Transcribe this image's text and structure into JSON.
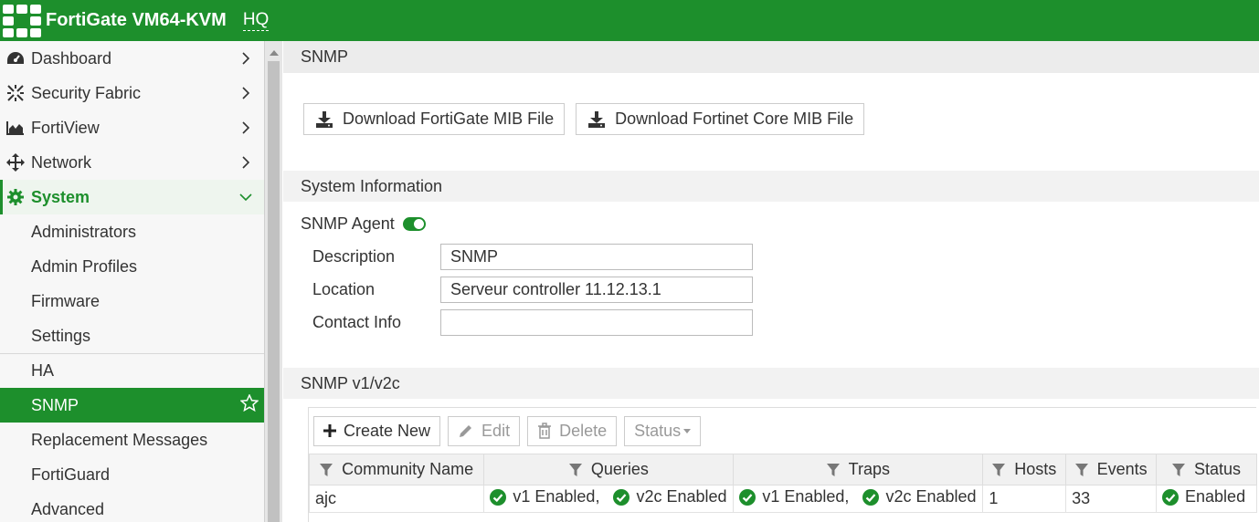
{
  "topbar": {
    "title": "FortiGate VM64-KVM",
    "vdom": "HQ"
  },
  "sidebar": {
    "items": [
      {
        "label": "Dashboard",
        "icon": "dashboard-icon"
      },
      {
        "label": "Security Fabric",
        "icon": "security-fabric-icon"
      },
      {
        "label": "FortiView",
        "icon": "fortiview-icon"
      },
      {
        "label": "Network",
        "icon": "network-move-icon"
      },
      {
        "label": "System",
        "icon": "gear-icon"
      }
    ],
    "system_children": [
      "Administrators",
      "Admin Profiles",
      "Firmware",
      "Settings",
      "HA",
      "SNMP",
      "Replacement Messages",
      "FortiGuard",
      "Advanced"
    ]
  },
  "page": {
    "title": "SNMP",
    "download_fortigate_mib": "Download FortiGate MIB File",
    "download_core_mib": "Download Fortinet Core MIB File",
    "system_info_header": "System Information",
    "snmp_agent_label": "SNMP Agent",
    "form": {
      "description_label": "Description",
      "description_value": "SNMP",
      "location_label": "Location",
      "location_value": "Serveur controller 11.12.13.1",
      "contact_label": "Contact Info",
      "contact_value": ""
    },
    "v1v2c_header": "SNMP v1/v2c"
  },
  "toolbar": {
    "create_new": "Create New",
    "edit": "Edit",
    "delete": "Delete",
    "status": "Status"
  },
  "table": {
    "columns": [
      "Community Name",
      "Queries",
      "Traps",
      "Hosts",
      "Events",
      "Status"
    ],
    "rows": [
      {
        "community": "ajc",
        "queries_v1": "v1 Enabled,",
        "queries_v2c": "v2c Enabled",
        "traps_v1": "v1 Enabled,",
        "traps_v2c": "v2c Enabled",
        "hosts": "1",
        "events": "33",
        "status": "Enabled"
      }
    ]
  },
  "colors": {
    "brand": "#1d8f2c"
  }
}
